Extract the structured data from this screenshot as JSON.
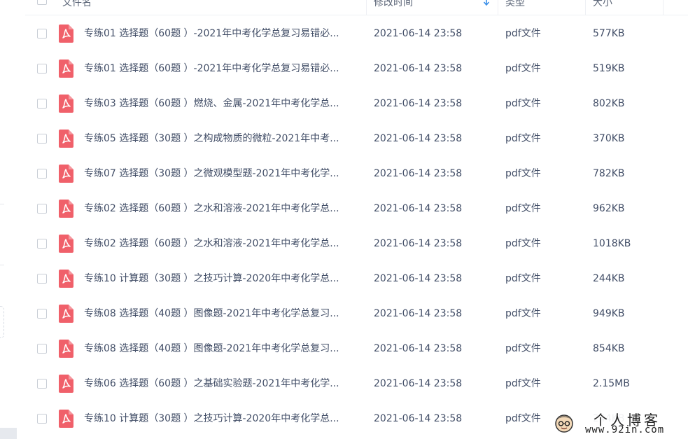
{
  "header": {
    "name_label": "文件名",
    "mtime_label": "修改时间",
    "type_label": "类型",
    "size_label": "大小"
  },
  "files": [
    {
      "name": "专练01 选择题（60题 ）-2021年中考化学总复习易错必...",
      "mtime": "2021-06-14 23:58",
      "type": "pdf文件",
      "size": "577KB"
    },
    {
      "name": "专练01 选择题（60题 ）-2021年中考化学总复习易错必...",
      "mtime": "2021-06-14 23:58",
      "type": "pdf文件",
      "size": "519KB"
    },
    {
      "name": "专练03 选择题（60题 ）燃烧、金属-2021年中考化学总...",
      "mtime": "2021-06-14 23:58",
      "type": "pdf文件",
      "size": "802KB"
    },
    {
      "name": "专练05 选择题（30题 ）之构成物质的微粒-2021年中考...",
      "mtime": "2021-06-14 23:58",
      "type": "pdf文件",
      "size": "370KB"
    },
    {
      "name": "专练07 选择题（30题 ）之微观模型题-2021年中考化学...",
      "mtime": "2021-06-14 23:58",
      "type": "pdf文件",
      "size": "782KB"
    },
    {
      "name": "专练02 选择题（60题 ）之水和溶液-2021年中考化学总...",
      "mtime": "2021-06-14 23:58",
      "type": "pdf文件",
      "size": "962KB"
    },
    {
      "name": "专练02 选择题（60题 ）之水和溶液-2021年中考化学总...",
      "mtime": "2021-06-14 23:58",
      "type": "pdf文件",
      "size": "1018KB"
    },
    {
      "name": "专练10 计算题（30题 ）之技巧计算-2020年中考化学总...",
      "mtime": "2021-06-14 23:58",
      "type": "pdf文件",
      "size": "244KB"
    },
    {
      "name": "专练08 选择题（40题 ）图像题-2021年中考化学总复习...",
      "mtime": "2021-06-14 23:58",
      "type": "pdf文件",
      "size": "949KB"
    },
    {
      "name": "专练08 选择题（40题 ）图像题-2021年中考化学总复习...",
      "mtime": "2021-06-14 23:58",
      "type": "pdf文件",
      "size": "854KB"
    },
    {
      "name": "专练06 选择题（60题 ）之基础实验题-2021年中考化学...",
      "mtime": "2021-06-14 23:58",
      "type": "pdf文件",
      "size": "2.15MB"
    },
    {
      "name": "专练10 计算题（30题 ）之技巧计算-2020年中考化学总...",
      "mtime": "2021-06-14 23:58",
      "type": "pdf文件",
      "size": "244KB"
    }
  ],
  "icons": {
    "file": "pdf-file-icon",
    "sort": "sort-arrow-down-icon",
    "checkbox": "checkbox-unchecked"
  },
  "colors": {
    "pdf_icon": "#f0606a",
    "sort_arrow": "#3b8fe8",
    "text": "#424e67",
    "header_text": "#5b6577",
    "divider": "#eef0f4"
  },
  "watermark": {
    "title": "个人博客",
    "url": "www.92in.com"
  }
}
